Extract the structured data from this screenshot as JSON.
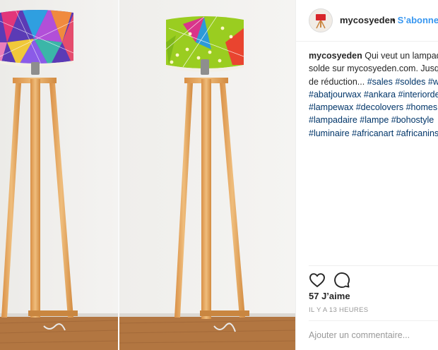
{
  "post": {
    "username": "mycosyeden",
    "follow_label": "S’abonner",
    "separator": "•",
    "caption": {
      "line1_text": "Qui veut un lampad",
      "line2_text": "solde sur mycosyeden.com. Jusq",
      "line3_text": "de réduction... ",
      "line3_tags": [
        "#sales",
        "#soldes",
        "#w"
      ],
      "line4_tags": [
        "#abatjourwax",
        "#ankara",
        "#interiorde"
      ],
      "line5_tags": [
        "#lampewax",
        "#decolovers",
        "#homes"
      ],
      "line6_tags": [
        "#lampadaire",
        "#lampe",
        "#bohostyle"
      ],
      "line7_tags": [
        "#luminaire",
        "#africanart",
        "#africanins"
      ]
    },
    "likes": "57 J’aime",
    "timestamp": "IL Y A 13 HEURES",
    "comment_placeholder": "Ajouter un commentaire...",
    "icons": {
      "like": "heart-icon",
      "comment": "comment-bubble-icon"
    },
    "colors": {
      "link": "#3897f0",
      "hashtag": "#003569",
      "muted": "#999999",
      "lamp_shade_left": "#7a3fd0",
      "lamp_shade_right": "#9acd20",
      "wood": "#e2a55e"
    }
  }
}
